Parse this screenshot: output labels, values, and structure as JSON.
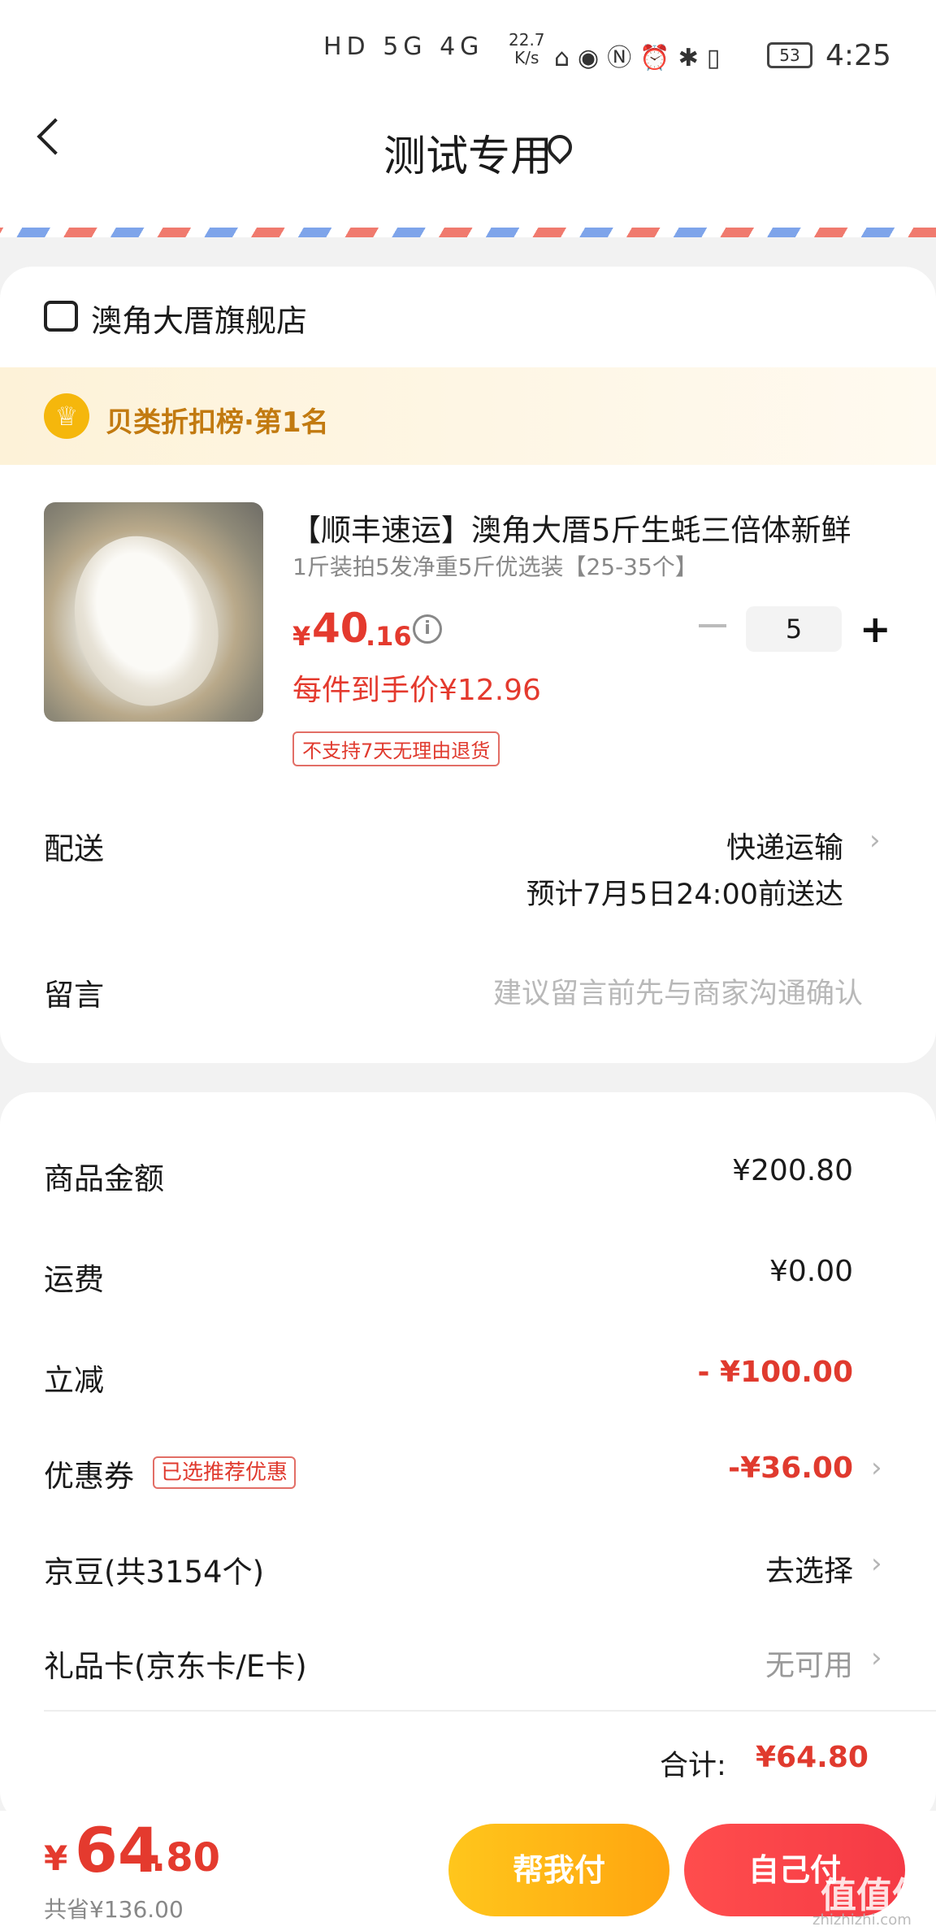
{
  "status_bar": {
    "time": "4:25",
    "network": "HD 5G 4G",
    "speed_value": "22.7",
    "speed_unit": "K/s",
    "battery": "53",
    "icons": [
      "signal-icon",
      "wifi-icon",
      "qq-icon",
      "eye-icon",
      "nfc-icon",
      "alarm-icon",
      "bluetooth-icon",
      "vibrate-icon",
      "battery-icon"
    ]
  },
  "header": {
    "title": "测试专用"
  },
  "store": {
    "name": "澳角大厝旗舰店"
  },
  "rank": {
    "text": "贝类折扣榜·第1名"
  },
  "product": {
    "title": "【顺丰速运】澳角大厝5斤生蚝三倍体新鲜",
    "spec": "1斤装拍5发净重5斤优选装【25-35个】",
    "price_currency": "¥",
    "price_int": "40",
    "price_dec": ".16",
    "quantity": "5",
    "minus_label": "",
    "plus_label": "+",
    "unit_price": "每件到手价¥12.96",
    "no_return_tag": "不支持7天无理由退货"
  },
  "delivery": {
    "label": "配送",
    "method": "快递运输",
    "eta": "预计7月5日24:00前送达"
  },
  "message": {
    "label": "留言",
    "placeholder": "建议留言前先与商家沟通确认"
  },
  "summary": {
    "goods_label": "商品金额",
    "goods_value": "¥200.80",
    "shipping_label": "运费",
    "shipping_value": "¥0.00",
    "discount_label": "立减",
    "discount_value": "- ¥100.00",
    "coupon_label": "优惠券",
    "coupon_tag": "已选推荐优惠",
    "coupon_value": "-¥36.00",
    "jingdou_label": "京豆(共3154个)",
    "jingdou_value": "去选择",
    "giftcard_label": "礼品卡(京东卡/E卡)",
    "giftcard_value": "无可用",
    "total_label": "合计:",
    "total_value": "¥64.80"
  },
  "bottom_bar": {
    "currency": "¥",
    "amount_int": "64",
    "amount_dec": ".80",
    "saved": "共省¥136.00",
    "help_pay_label": "帮我付",
    "self_pay_label": "自己付",
    "watermark": "值值值",
    "watermark_sub": "zhizhizhi.com"
  },
  "colors": {
    "accent_red": "#e43a2e",
    "help_button": "#ffb215",
    "self_button": "#f5414a"
  }
}
